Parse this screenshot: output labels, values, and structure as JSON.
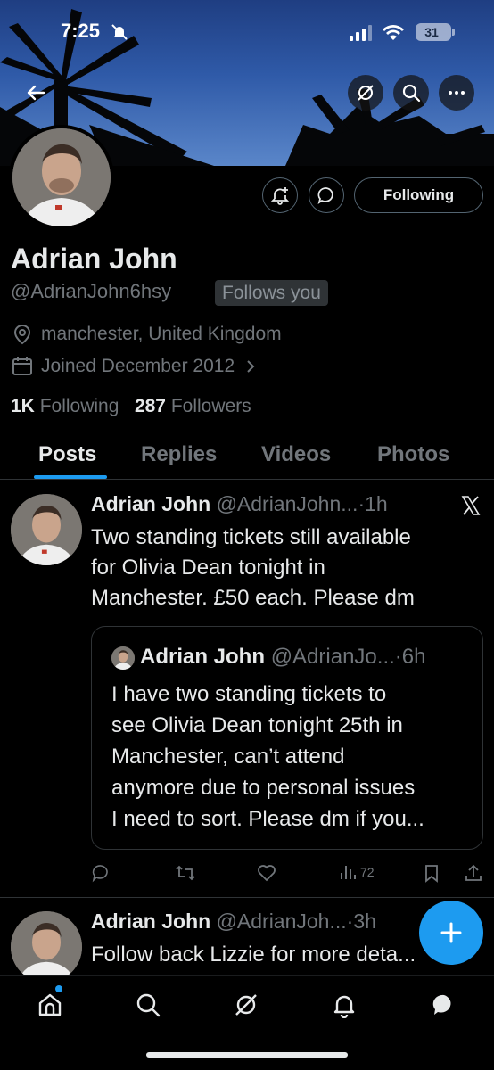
{
  "status_bar": {
    "time": "7:25",
    "battery": "31"
  },
  "profile": {
    "name": "Adrian John",
    "handle": "@AdrianJohn6hsy",
    "follows_you": "Follows you",
    "location": "manchester, United Kingdom",
    "joined": "Joined December 2012",
    "following_count": "1K",
    "following_label": "Following",
    "followers_count": "287",
    "followers_label": "Followers",
    "follow_button": "Following"
  },
  "tabs": [
    {
      "label": "Posts",
      "active": true
    },
    {
      "label": "Replies",
      "active": false
    },
    {
      "label": "Videos",
      "active": false
    },
    {
      "label": "Photos",
      "active": false
    }
  ],
  "posts": [
    {
      "name": "Adrian John",
      "handle": "@AdrianJohn...",
      "time": "1h",
      "text_lines": [
        "Two standing tickets still available",
        "for Olivia Dean tonight in",
        "Manchester. £50 each. Please dm"
      ],
      "quote": {
        "name": "Adrian John",
        "handle": "@AdrianJo...",
        "time": "6h",
        "text_lines": [
          "I have two standing tickets to",
          "see Olivia Dean tonight 25th in",
          "Manchester, can’t attend",
          "anymore due to personal issues",
          "I need to sort. Please dm if you..."
        ]
      },
      "views": "72"
    },
    {
      "name": "Adrian John",
      "handle": "@AdrianJoh...",
      "time": "3h",
      "text_lines": [
        "Follow back Lizzie for more deta..."
      ]
    }
  ],
  "colors": {
    "accent": "#1d9bf0",
    "muted": "#71767b",
    "border": "#2f3336"
  },
  "icons": [
    "back-arrow-icon",
    "grok-icon",
    "search-icon",
    "more-icon",
    "notification-bell-plus-icon",
    "message-icon",
    "location-icon",
    "calendar-icon",
    "chevron-right-icon",
    "x-logo-icon",
    "reply-icon",
    "retweet-icon",
    "like-icon",
    "views-icon",
    "bookmark-icon",
    "share-icon",
    "compose-plus-icon",
    "home-icon",
    "explore-icon",
    "notifications-icon",
    "messages-icon"
  ]
}
